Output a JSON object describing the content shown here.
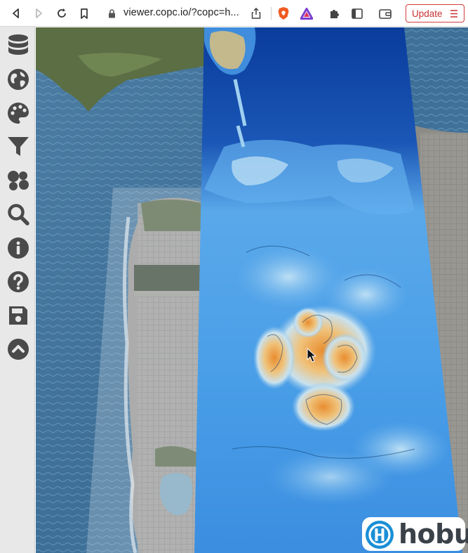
{
  "browser": {
    "url": "viewer.copc.io/?copc=h...",
    "update_label": "Update"
  },
  "sidebar": {
    "items": [
      {
        "icon": "database-icon"
      },
      {
        "icon": "globe-icon"
      },
      {
        "icon": "palette-icon"
      },
      {
        "icon": "filter-icon"
      },
      {
        "icon": "point-cloud-icon"
      },
      {
        "icon": "search-icon"
      },
      {
        "icon": "info-icon"
      },
      {
        "icon": "help-icon"
      },
      {
        "icon": "save-icon"
      },
      {
        "icon": "collapse-up-icon"
      }
    ]
  },
  "branding": {
    "logo_text": "hobu"
  },
  "colors": {
    "update_border": "#d33b3b",
    "sidebar_bg": "#e8e8e8",
    "sidebar_icon": "#4a4a4a",
    "ocean": "#3d6d94",
    "elevation_low": "#0b3fa0",
    "elevation_mid": "#4f9fe6",
    "elevation_high": "#e8963c",
    "hobu_blue": "#1a8fd6"
  }
}
